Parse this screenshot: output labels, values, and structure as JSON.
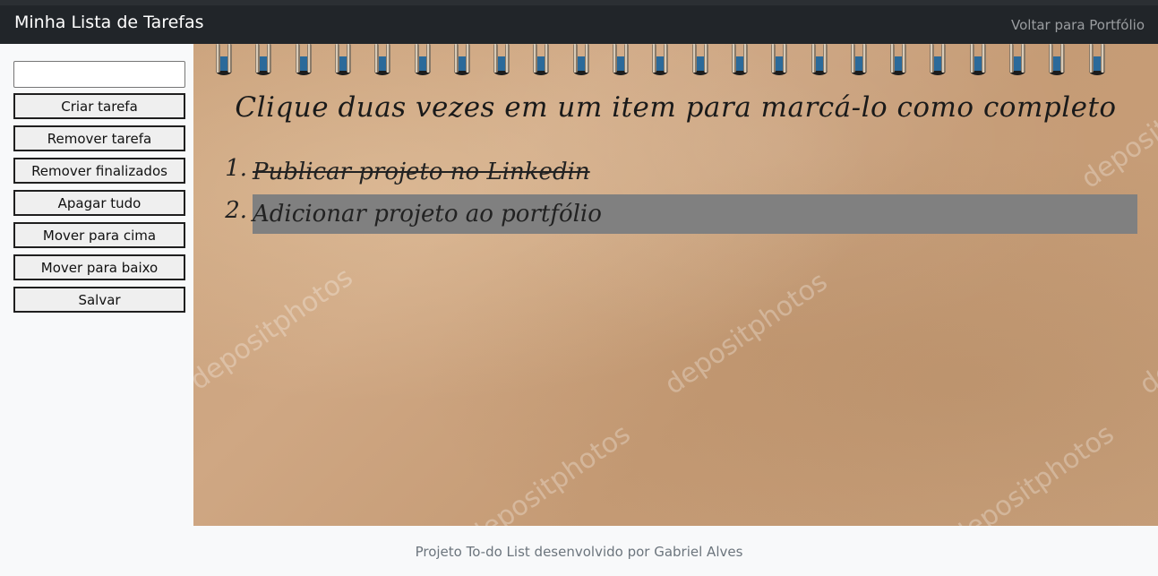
{
  "navbar": {
    "brand": "Minha Lista de Tarefas",
    "back_link": "Voltar para Portfólio"
  },
  "sidebar": {
    "task_input": {
      "value": "",
      "placeholder": ""
    },
    "buttons": [
      "Criar tarefa",
      "Remover tarefa",
      "Remover finalizados",
      "Apagar tudo",
      "Mover para cima",
      "Mover para baixo",
      "Salvar"
    ]
  },
  "main": {
    "instruction": "Clique duas vezes em um item para marcá-lo como completo",
    "watermark_text": "depositphotos",
    "tasks": [
      {
        "number": "1.",
        "text": "Publicar projeto no Linkedin",
        "completed": true,
        "selected": false
      },
      {
        "number": "2.",
        "text": "Adicionar projeto ao portfólio",
        "completed": false,
        "selected": true
      }
    ]
  },
  "footer": {
    "text": "Projeto To-do List desenvolvido por Gabriel Alves"
  },
  "colors": {
    "navbar_bg": "#212529",
    "selected_task_bg": "#808080",
    "button_bg": "#efefef",
    "notebook_paper": "#c9a07a"
  }
}
